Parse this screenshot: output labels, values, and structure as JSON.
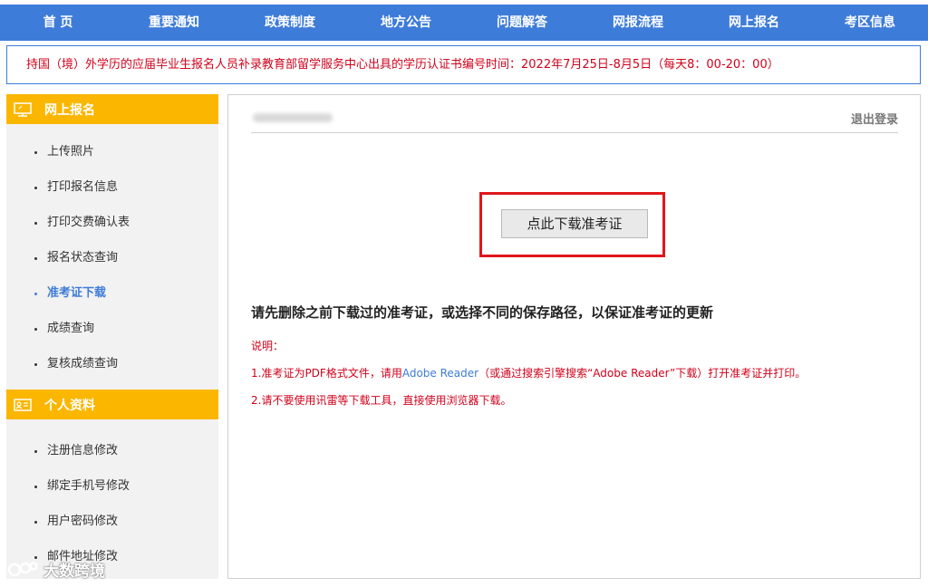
{
  "nav": {
    "items": [
      "首 页",
      "重要通知",
      "政策制度",
      "地方公告",
      "问题解答",
      "网报流程",
      "网上报名",
      "考区信息"
    ]
  },
  "notice": {
    "text": "持国（境）外学历的应届毕业生报名人员补录教育部留学服务中心出具的学历认证书编号时间：2022年7月25日-8月5日（每天8：00-20：00）"
  },
  "sidebar": {
    "section1": {
      "title": "网上报名",
      "icon": "monitor-icon",
      "items": [
        "上传照片",
        "打印报名信息",
        "打印交费确认表",
        "报名状态查询",
        "准考证下载",
        "成绩查询",
        "复核成绩查询"
      ],
      "active": "准考证下载"
    },
    "section2": {
      "title": "个人资料",
      "icon": "id-card-icon",
      "items": [
        "注册信息修改",
        "绑定手机号修改",
        "用户密码修改",
        "邮件地址修改"
      ]
    }
  },
  "main": {
    "logout": "退出登录",
    "download_button": "点此下载准考证",
    "warning": "请先删除之前下载过的准考证，或选择不同的保存路径，以保证准考证的更新",
    "note_label": "说明：",
    "note1_before": "1.准考证为PDF格式文件，请用",
    "note1_link": "Adobe Reader",
    "note1_after": "（或通过搜索引擎搜索“Adobe Reader”下载）打开准考证并打印。",
    "note2": "2.请不要使用讯雷等下载工具，直接使用浏览器下载。"
  },
  "watermark": {
    "text": "大数跨境"
  },
  "colors": {
    "nav": "#3e7cd9",
    "sidebar_header": "#fbb600",
    "alert_red": "#d0021b",
    "highlight_box": "#e0161b"
  }
}
